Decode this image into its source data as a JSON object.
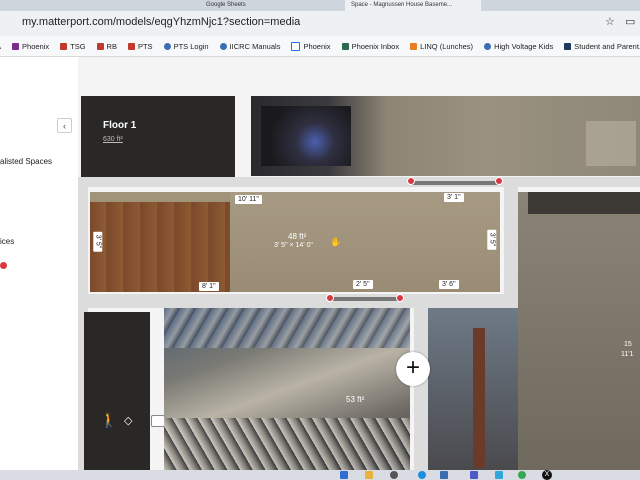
{
  "browser": {
    "tabs": [
      "",
      "Google Sheets",
      "",
      "Space - Magnussen House Baseme...",
      ""
    ],
    "url": "my.matterport.com/models/eqgYhzmNjc1?section=media",
    "bookmarks": [
      {
        "label": "A",
        "color": "#4a5fa8"
      },
      {
        "label": "Phoenix",
        "color": "#7b2d8b"
      },
      {
        "label": "TSG",
        "color": "#c0392b"
      },
      {
        "label": "RB",
        "color": "#c0392b"
      },
      {
        "label": "PTS",
        "color": "#c0392b"
      },
      {
        "label": "PTS Login",
        "color": "#3b6db3"
      },
      {
        "label": "IICRC Manuals",
        "color": "#3b6db3"
      },
      {
        "label": "Phoenix",
        "color": "#1a73e8"
      },
      {
        "label": "Phoenix Inbox",
        "color": "#2d6a4f"
      },
      {
        "label": "LINQ (Lunches)",
        "color": "#e67e22"
      },
      {
        "label": "High Voltage Kids",
        "color": "#3b6db3"
      },
      {
        "label": "Student and Parent...",
        "color": "#1f3a5f"
      }
    ]
  },
  "sidebar": {
    "spaces_label": "alisted Spaces",
    "devices_label": "ices",
    "collapse_icon": "chevron-left-icon"
  },
  "floor": {
    "name": "Floor 1",
    "area": "630 ft²"
  },
  "measurements": {
    "top_width": "10' 11\"",
    "right_top": "3' 1\"",
    "left_height": "3' 5\"",
    "right_height": "3' 5\"",
    "bottom_left": "8' 1\"",
    "bottom_door": "2' 5\"",
    "bottom_right": "3' 6\"",
    "room_area": "48 ft²",
    "room_dims": "3' 5\" × 14' 0\"",
    "lower_area": "53 ft²",
    "edge_num1": "15",
    "edge_num2": "11'1"
  },
  "controls": {
    "add_icon": "plus-icon",
    "walk_icon": "walk-icon",
    "tag_icon": "tag-icon",
    "note_icon": "comment-icon"
  },
  "colors": {
    "pin": "#d7383d",
    "panel": "#ffffff",
    "dark_card": "#2a2827"
  }
}
